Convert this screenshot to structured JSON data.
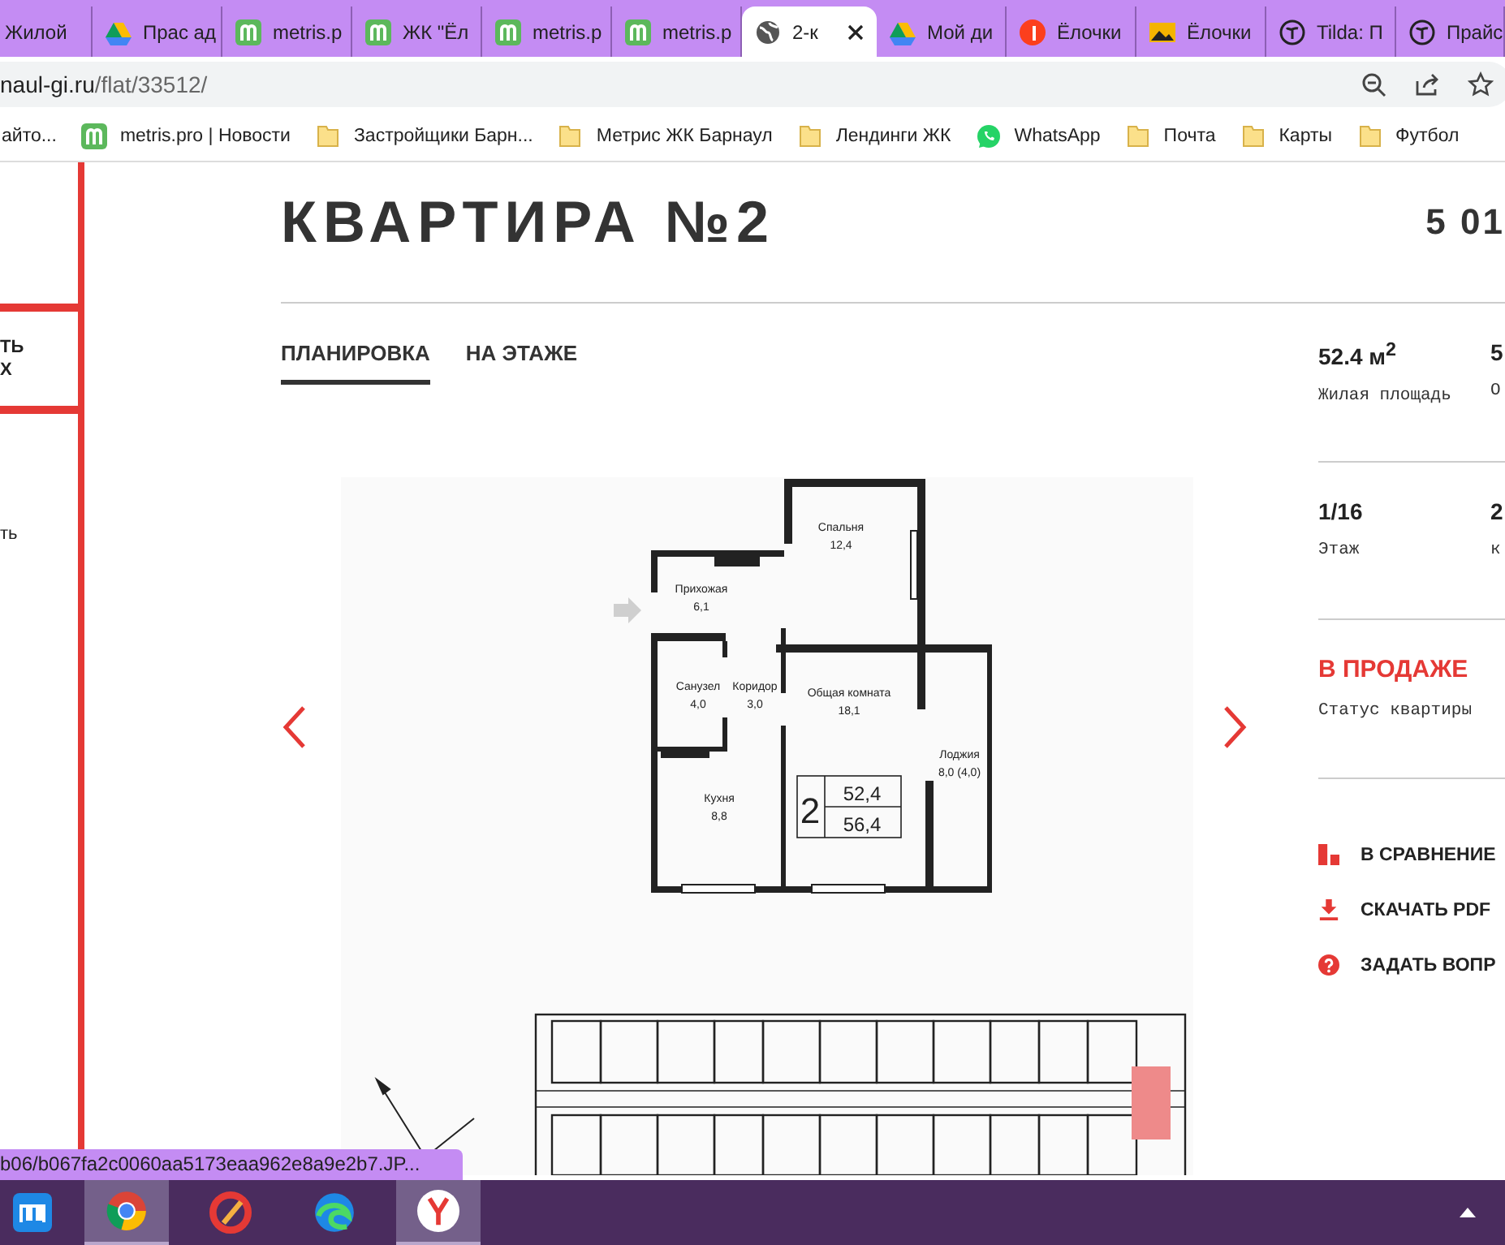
{
  "browser": {
    "tabs": [
      {
        "title": "Жилой",
        "selected": false
      },
      {
        "title": "Прас ад",
        "kind": "drive",
        "selected": false
      },
      {
        "title": "metris.p",
        "kind": "metris",
        "selected": false
      },
      {
        "title": "ЖК \"Ёл",
        "kind": "metris",
        "selected": false
      },
      {
        "title": "metris.p",
        "kind": "metris",
        "selected": false
      },
      {
        "title": "metris.p",
        "kind": "metris",
        "selected": false
      },
      {
        "title": "2-к",
        "kind": "globe",
        "selected": true
      },
      {
        "title": "Мой ди",
        "kind": "drive",
        "selected": false
      },
      {
        "title": "Ёлочки",
        "kind": "yandex",
        "selected": false
      },
      {
        "title": "Ёлочки",
        "kind": "image",
        "selected": false
      },
      {
        "title": "Tilda: П",
        "kind": "tilda",
        "selected": false
      },
      {
        "title": "Прайс",
        "kind": "tilda",
        "selected": false
      }
    ],
    "address": {
      "host": "naul-gi.ru",
      "path": "/flat/33512/"
    },
    "bookmarks": [
      {
        "label": "айто..."
      },
      {
        "label": "metris.pro | Новости",
        "kind": "metris"
      },
      {
        "label": "Застройщики Барн...",
        "kind": "folder"
      },
      {
        "label": "Метрис ЖК Барнаул",
        "kind": "folder"
      },
      {
        "label": "Лендинги ЖК",
        "kind": "folder"
      },
      {
        "label": "WhatsApp",
        "kind": "whatsapp"
      },
      {
        "label": "Почта",
        "kind": "folder"
      },
      {
        "label": "Карты",
        "kind": "folder"
      },
      {
        "label": "Футбол",
        "kind": "folder"
      }
    ],
    "status_url": "b06/b067fa2c0060aa5173eaa962e8a9e2b7.JP..."
  },
  "sidebar": {
    "texts": [
      "ТЬ",
      "Х",
      "ть"
    ]
  },
  "page": {
    "title": "КВАРТИРА №2",
    "price": "5 01",
    "tabs": [
      {
        "label": "ПЛАНИРОВКА",
        "selected": true
      },
      {
        "label": "НА ЭТАЖЕ",
        "selected": false
      }
    ],
    "plan_labels": [
      {
        "name": "Спальня",
        "area": "12,4"
      },
      {
        "name": "Прихожая",
        "area": "6,1"
      },
      {
        "name": "Санузел",
        "area": "4,0"
      },
      {
        "name": "Коридор",
        "area": "3,0"
      },
      {
        "name": "Общая комната",
        "area": "18,1"
      },
      {
        "name": "Лоджия",
        "area": "8,0 (4,0)"
      },
      {
        "name": "Кухня",
        "area": "8,8"
      }
    ],
    "plan_box": {
      "rooms": "2",
      "living_area": "52,4",
      "total_area": "56,4"
    },
    "stats": [
      {
        "value": "52.4 м$^{2}$",
        "label": "Жилая площадь"
      },
      {
        "value": "5",
        "label": "О"
      },
      {
        "value": "1/16",
        "label": "Этаж"
      },
      {
        "value": "2",
        "label": "к"
      }
    ],
    "status": {
      "value": "В ПРОДАЖЕ",
      "label": "Статус квартиры"
    },
    "actions": [
      {
        "kind": "compare",
        "label": "В СРАВНЕНИЕ"
      },
      {
        "kind": "download",
        "label": "СКАЧАТЬ PDF"
      },
      {
        "kind": "question",
        "label": "ЗАДАТЬ ВОПР"
      }
    ]
  },
  "taskbar": {
    "apps": [
      {
        "kind": "square",
        "selected": false
      },
      {
        "kind": "ring",
        "selected": true
      },
      {
        "kind": "broom",
        "selected": false
      },
      {
        "kind": "swirl",
        "selected": false
      },
      {
        "kind": "y",
        "selected": true
      }
    ]
  }
}
